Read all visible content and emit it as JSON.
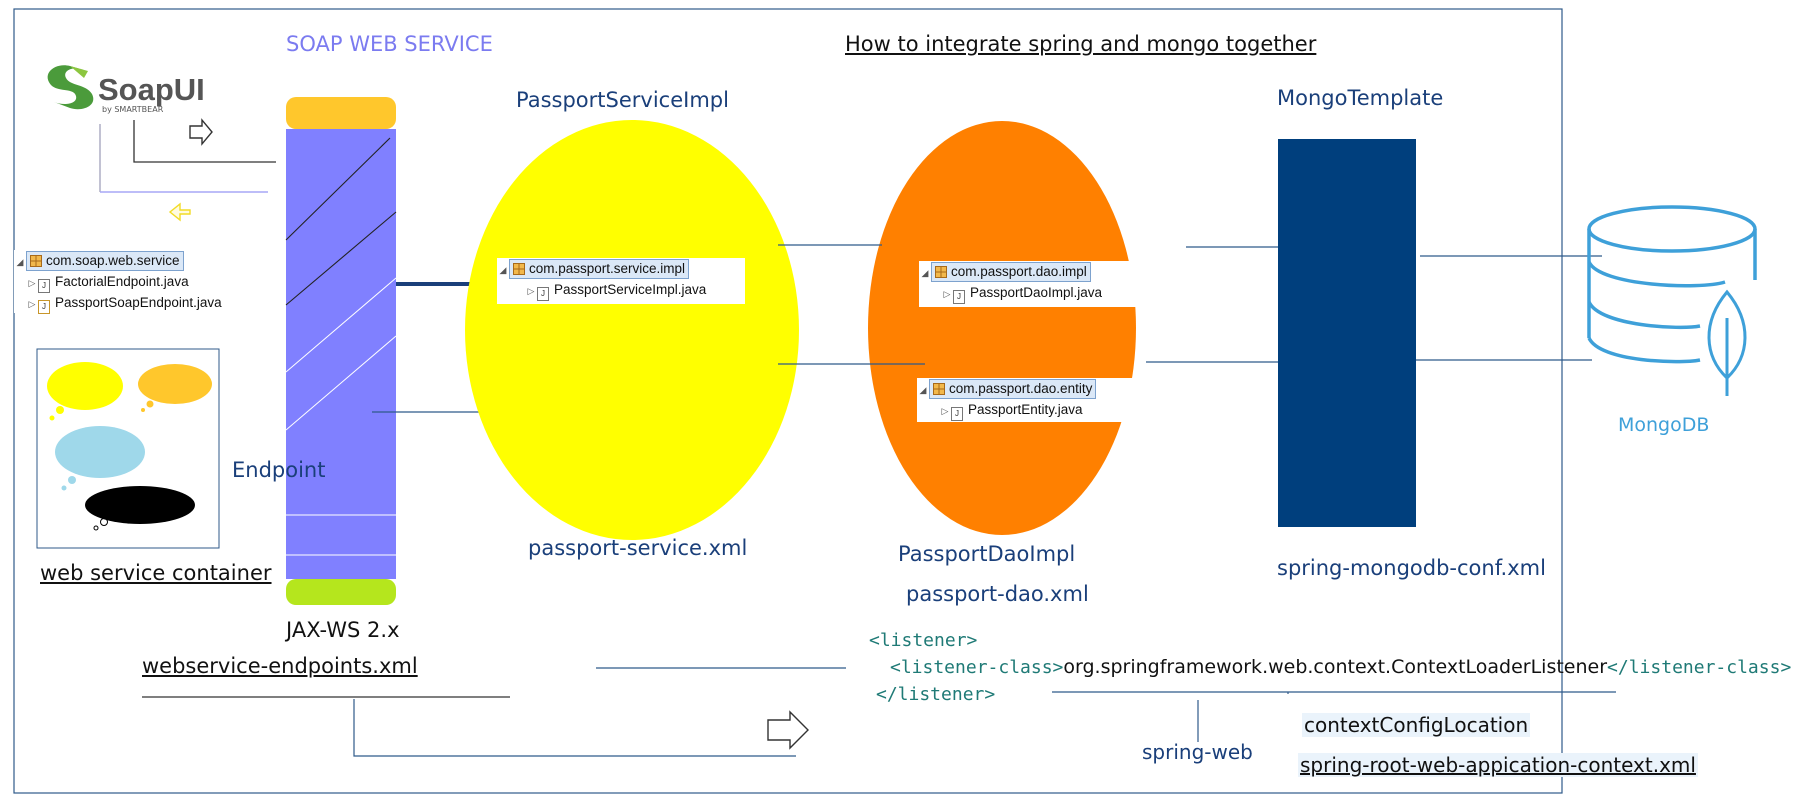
{
  "title": "How to integrate spring and mongo together",
  "soap_ws_label": "SOAP WEB SERVICE",
  "soapui": {
    "name": "SoapUI",
    "by": "by SMARTBEAR"
  },
  "soap_tree": {
    "package": "com.soap.web.service",
    "files": [
      "FactorialEndpoint.java",
      "PassportSoapEndpoint.java"
    ]
  },
  "container_label": "web service container",
  "endpoint_label": "Endpoint",
  "jaxws_label": "JAX-WS 2.x",
  "endpoints_xml": "webservice-endpoints.xml",
  "service": {
    "title": "PassportServiceImpl",
    "package": "com.passport.service.impl",
    "file": "PassportServiceImpl.java",
    "xml": "passport-service.xml"
  },
  "dao": {
    "impl_package": "com.passport.dao.impl",
    "impl_file": "PassportDaoImpl.java",
    "entity_package": "com.passport.dao.entity",
    "entity_file": "PassportEntity.java",
    "title": "PassportDaoImpl",
    "xml": "passport-dao.xml"
  },
  "mongo_template": {
    "title": "MongoTemplate",
    "xml": "spring-mongodb-conf.xml"
  },
  "mongodb_label": "MongoDB",
  "listener": {
    "open": "<listener>",
    "class_open": "<listener-class>",
    "class_value": "org.springframework.web.context.ContextLoaderListener",
    "class_close": "</listener-class>",
    "close": "</listener>"
  },
  "spring_web": "spring-web",
  "context_config": "contextConfigLocation",
  "root_context_xml": "spring-root-web-appication-context.xml",
  "colors": {
    "frame": "#2f5a8a",
    "soap_label": "#7b7bf0",
    "endpoint_bar": "#8080ff",
    "bar_top": "#ffc72c",
    "bar_bottom": "#b5e61d",
    "service_ellipse": "#ffff00",
    "dao_ellipse": "#ff8000",
    "mongo_template": "#003f7d",
    "mongodb": "#3ea0d9",
    "label_blue": "#1a3f7a",
    "xml_tag": "#1f7a76"
  }
}
